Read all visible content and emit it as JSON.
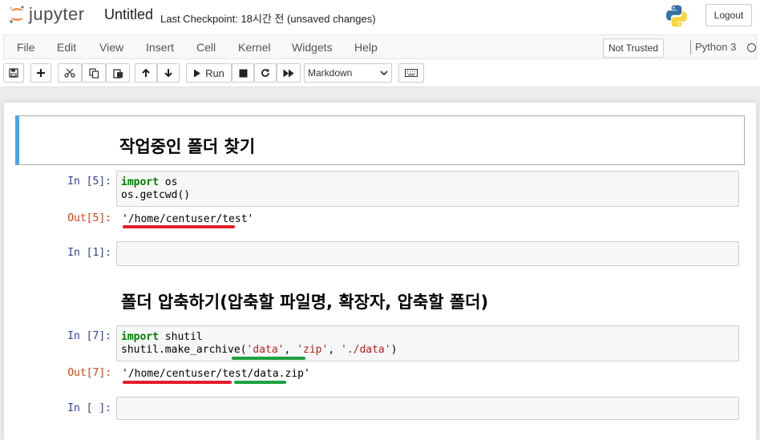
{
  "header": {
    "logo_text": "jupyter",
    "notebook_title": "Untitled",
    "checkpoint": "Last Checkpoint: 18시간 전  (unsaved changes)",
    "logout_label": "Logout"
  },
  "menubar": {
    "items": [
      "File",
      "Edit",
      "View",
      "Insert",
      "Cell",
      "Kernel",
      "Widgets",
      "Help"
    ],
    "trust_label": "Not Trusted",
    "kernel_name": "Python 3"
  },
  "toolbar": {
    "run_label": "Run",
    "cell_type": "Markdown",
    "icons": [
      "save-icon",
      "plus-icon",
      "cut-icon",
      "copy-icon",
      "paste-icon",
      "arrow-up-icon",
      "arrow-down-icon",
      "run-icon",
      "stop-icon",
      "restart-icon",
      "fast-forward-icon",
      "keyboard-icon"
    ]
  },
  "cells": {
    "md1": "작업중인 폴더 찾기",
    "in5_prompt": "In [5]:",
    "in5_line1_kw": "import",
    "in5_line1_rest": " os",
    "in5_line2": "os.getcwd()",
    "out5_prompt": "Out[5]:",
    "out5_text": "'/home/centuser/test'",
    "in1_prompt": "In [1]:",
    "md2": "폴더 압축하기(압축할 파일명, 확장자, 압축할 폴더)",
    "in7_prompt": "In [7]:",
    "in7_line1_kw": "import",
    "in7_line1_rest": " shutil",
    "in7_line2_a": "shutil.make_archive(",
    "in7_line2_s1": "'data'",
    "in7_line2_c1": ", ",
    "in7_line2_s2": "'zip'",
    "in7_line2_c2": ", ",
    "in7_line2_s3": "'./data'",
    "in7_line2_end": ")",
    "out7_prompt": "Out[7]:",
    "out7_text": "'/home/centuser/test/data.zip'",
    "empty_prompt": "In [ ]:"
  },
  "colors": {
    "selected_cell_border": "#42a5f5",
    "annotation_red": "#e0202a",
    "annotation_green": "#20a040"
  }
}
